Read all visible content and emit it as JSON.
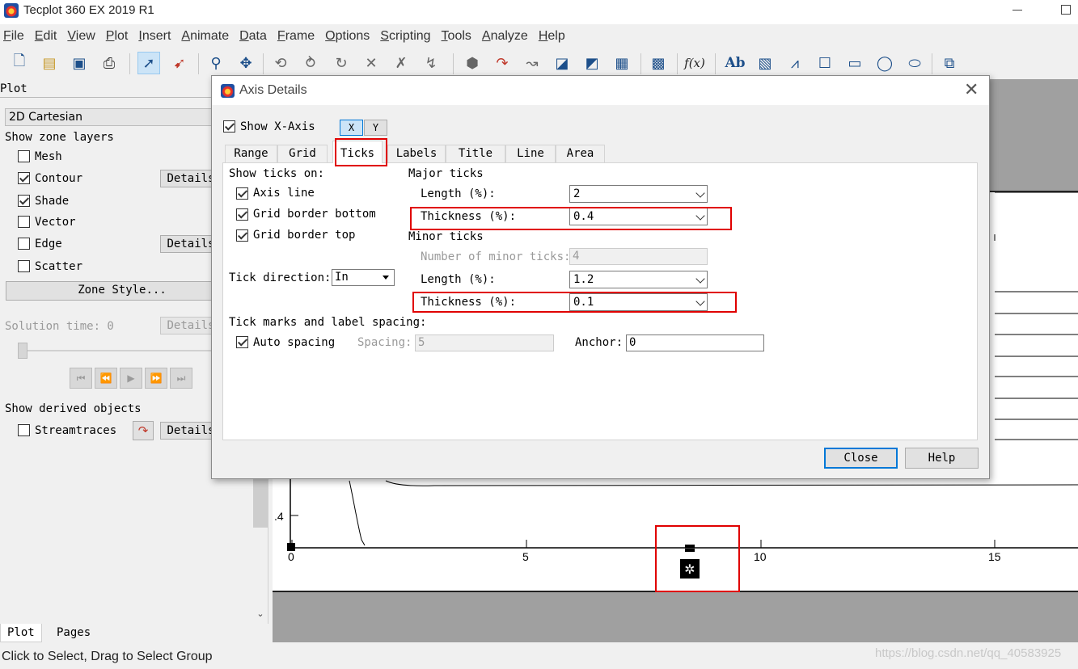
{
  "app": {
    "title": "Tecplot 360 EX 2019 R1"
  },
  "menu": [
    "File",
    "Edit",
    "View",
    "Plot",
    "Insert",
    "Animate",
    "Data",
    "Frame",
    "Options",
    "Scripting",
    "Tools",
    "Analyze",
    "Help"
  ],
  "toolbar": {
    "icons": [
      "new-file-icon",
      "open-file-icon",
      "save-icon",
      "print-icon",
      "selector-arrow-icon",
      "adjustor-arrow-icon",
      "zoom-icon",
      "translate-icon",
      "rotate-spherical-icon",
      "rotate-rollerball-icon",
      "rotate-twist-icon",
      "rotate-x-icon",
      "rotate-y-icon",
      "rotate-z-icon",
      "probe-icon",
      "streamtrace-icon",
      "slice-icon",
      "contour-add-icon",
      "contour-remove-icon",
      "contour-level-icon",
      "zone-edit-icon",
      "formula-icon",
      "text-icon",
      "geometry-image-icon",
      "polyline-icon",
      "square-icon",
      "rectangle-icon",
      "circle-icon",
      "ellipse-icon",
      "frame-icon"
    ],
    "formula_label": "f(x)",
    "text_label": "Ab"
  },
  "sidebar": {
    "title": "Plot",
    "plot_type": "2D Cartesian",
    "zone_layers_label": "Show zone layers",
    "layers": [
      {
        "label": "Mesh",
        "checked": false
      },
      {
        "label": "Contour",
        "checked": true
      },
      {
        "label": "Shade",
        "checked": true
      },
      {
        "label": "Vector",
        "checked": false
      },
      {
        "label": "Edge",
        "checked": false
      },
      {
        "label": "Scatter",
        "checked": false
      }
    ],
    "details_label": "Details",
    "zone_style_label": "Zone Style...",
    "solution_time_label": "Solution time: 0",
    "derived_label": "Show derived objects",
    "streamtraces_label": "Streamtraces",
    "bottom_tabs": [
      "Plot",
      "Pages"
    ]
  },
  "plot": {
    "x_ticks": [
      "0",
      "5",
      "10",
      "15"
    ],
    "y_tick": ".4"
  },
  "status": {
    "text": "Click to Select, Drag to Select Group",
    "watermark": "https://blog.csdn.net/qq_40583925"
  },
  "dialog": {
    "title": "Axis Details",
    "show_axis_label": "Show X-Axis",
    "show_axis_checked": true,
    "axis_x": "X",
    "axis_y": "Y",
    "tabs": [
      "Range",
      "Grid",
      "Ticks",
      "Labels",
      "Title",
      "Line",
      "Area"
    ],
    "active_tab": "Ticks",
    "show_ticks_on_label": "Show ticks on:",
    "show_ticks": [
      {
        "label": "Axis line",
        "checked": true
      },
      {
        "label": "Grid border bottom",
        "checked": true
      },
      {
        "label": "Grid border top",
        "checked": true
      }
    ],
    "tick_direction_label": "Tick direction:",
    "tick_direction_value": "In",
    "major_ticks_label": "Major ticks",
    "major_length_label": "Length (%):",
    "major_length_value": "2",
    "major_thickness_label": "Thickness (%):",
    "major_thickness_value": "0.4",
    "minor_ticks_label": "Minor ticks",
    "num_minor_label": "Number of minor ticks:",
    "num_minor_value": "4",
    "minor_length_label": "Length (%):",
    "minor_length_value": "1.2",
    "minor_thickness_label": "Thickness (%):",
    "minor_thickness_value": "0.1",
    "spacing_section_label": "Tick marks and label spacing:",
    "auto_spacing_label": "Auto spacing",
    "auto_spacing_checked": true,
    "spacing_label": "Spacing:",
    "spacing_value": "5",
    "anchor_label": "Anchor:",
    "anchor_value": "0",
    "close_label": "Close",
    "help_label": "Help"
  },
  "colors": {
    "highlight": "#e00000",
    "accent": "#0078d7"
  }
}
